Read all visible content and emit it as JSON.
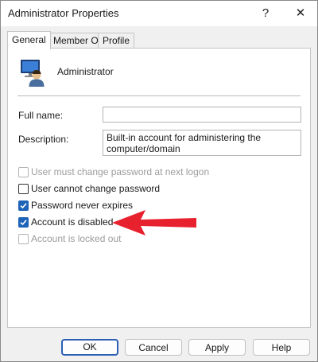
{
  "window": {
    "title": "Administrator Properties"
  },
  "titlebar": {
    "help_label": "?",
    "close_label": "✕"
  },
  "tabs": [
    {
      "label": "General",
      "active": true
    },
    {
      "label": "Member Of",
      "active": false
    },
    {
      "label": "Profile",
      "active": false
    }
  ],
  "general": {
    "user_name": "Administrator",
    "full_name": {
      "label": "Full name:",
      "value": ""
    },
    "description": {
      "label": "Description:",
      "value": "Built-in account for administering the computer/domain"
    }
  },
  "options": [
    {
      "label": "User must change password at next logon",
      "checked": false,
      "enabled": false
    },
    {
      "label": "User cannot change password",
      "checked": false,
      "enabled": true
    },
    {
      "label": "Password never expires",
      "checked": true,
      "enabled": true
    },
    {
      "label": "Account is disabled",
      "checked": true,
      "enabled": true
    },
    {
      "label": "Account is locked out",
      "checked": false,
      "enabled": false
    }
  ],
  "buttons": {
    "ok": "OK",
    "cancel": "Cancel",
    "apply": "Apply",
    "help": "Help"
  },
  "colors": {
    "checkbox_accent": "#1d63b8",
    "annotation_arrow": "#e8212e",
    "default_button_border": "#2b5fb5"
  },
  "icons": {
    "user": "user-account-icon",
    "annotation": "red-arrow-icon"
  }
}
